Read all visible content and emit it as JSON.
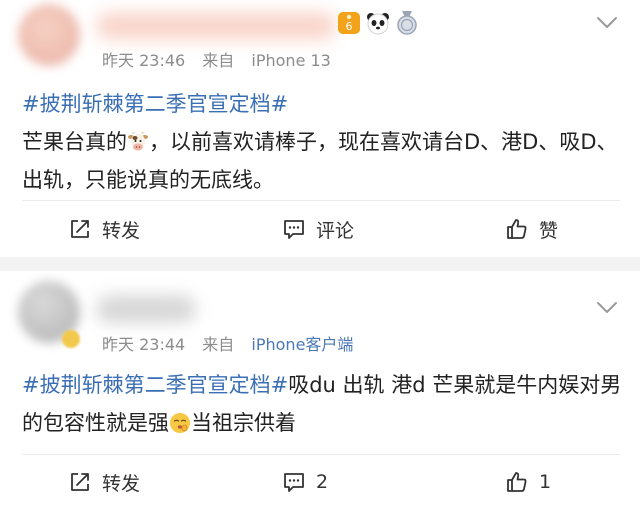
{
  "posts": [
    {
      "time": "昨天 23:46",
      "source_prefix": "来自",
      "source": "iPhone 13",
      "badge_level": "6",
      "content": {
        "topic": "#披荆斩棘第二季官宣定档#",
        "line1_text": "芒果台真的",
        "line1_emoji": "cow-face-emoji",
        "line1_rest": "，以前喜欢请棒子，现在喜欢请台D、港D、吸D、出轨，只能说真的无底线。"
      },
      "actions": {
        "repost": "转发",
        "comment": "评论",
        "like": "赞"
      }
    },
    {
      "time": "昨天 23:44",
      "source_prefix": "来自",
      "source": "iPhone客户端",
      "content": {
        "topic": "#披荆斩棘第二季官宣定档#",
        "text_before_emoji": "吸du 出轨 港d 芒果就是牛内娱对男的包容性就是强",
        "emoji": "shushing-face-emoji",
        "text_after_emoji": "当祖宗供着"
      },
      "actions": {
        "repost": "转发",
        "comment": "2",
        "like": "1"
      }
    }
  ],
  "colors": {
    "topic": "#3b6fb5",
    "source_link": "#4a79b5",
    "meta": "#8c8c8c",
    "text": "#222222"
  }
}
